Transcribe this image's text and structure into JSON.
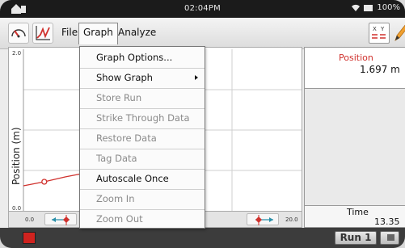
{
  "statusbar": {
    "time": "02:04PM",
    "battery": "100%"
  },
  "menubar": {
    "file": "File",
    "graph": "Graph",
    "analyze": "Analyze"
  },
  "icons": {
    "meter": "meter-gauge-icon",
    "graph": "graph-view-icon",
    "table": "xy-table-icon",
    "pencil": "pencil-icon"
  },
  "graph": {
    "ylabel": "Position (m)",
    "y_top_tick": "2.0",
    "y_bottom_tick": "0.0",
    "x_left_tick": "0.0",
    "x_right_tick": "20.0",
    "line_color": "#d0312d"
  },
  "chart_data": {
    "type": "line",
    "ylabel": "Position (m)",
    "xlim": [
      0,
      20
    ],
    "ylim": [
      0,
      2
    ],
    "grid": true,
    "series": [
      {
        "x": [
          0.0,
          1.5,
          3.0,
          4.5,
          6.0,
          7.5,
          9.0
        ],
        "y": [
          0.31,
          0.36,
          0.42,
          0.47,
          0.52,
          0.54,
          0.56
        ]
      }
    ],
    "marker_x": [
      1.5,
      4.5,
      7.5
    ]
  },
  "meter": {
    "position_label": "Position",
    "position_value": "1.697 m"
  },
  "time_meter": {
    "label": "Time",
    "value": "13.35"
  },
  "dropdown": {
    "items": [
      {
        "label": "Graph Options...",
        "enabled": true
      },
      {
        "label": "Show Graph",
        "enabled": true,
        "submenu": true
      },
      {
        "label": "Store Run",
        "enabled": false
      },
      {
        "label": "Strike Through Data",
        "enabled": false
      },
      {
        "label": "Restore Data",
        "enabled": false
      },
      {
        "label": "Tag Data",
        "enabled": false
      },
      {
        "label": "Autoscale Once",
        "enabled": true
      },
      {
        "label": "Zoom In",
        "enabled": false
      },
      {
        "label": "Zoom Out",
        "enabled": false
      }
    ]
  },
  "bottombar": {
    "run_label": "Run 1"
  },
  "colors": {
    "accent_red": "#d0312d",
    "stop_red": "#d0231f",
    "statusbar_bg": "#1b1b1b",
    "bottombar_bg": "#3c3c3c"
  }
}
